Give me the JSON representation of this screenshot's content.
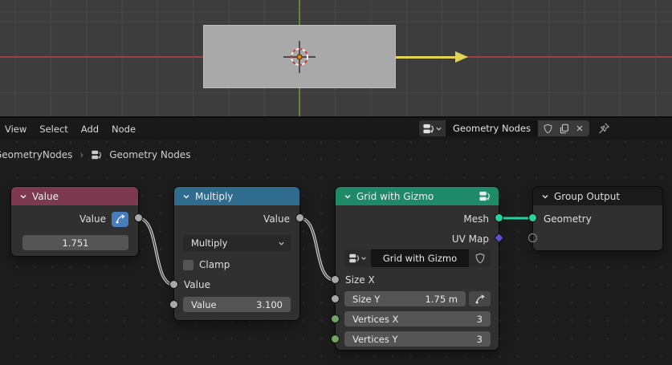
{
  "editor_header": {
    "menus": [
      {
        "label": "View"
      },
      {
        "label": "Select"
      },
      {
        "label": "Add"
      },
      {
        "label": "Node"
      }
    ],
    "tree_selector": {
      "name": "Geometry Nodes"
    }
  },
  "breadcrumb": {
    "modifier": "GeometryNodes",
    "separator": "›",
    "tree_name": "Geometry Nodes"
  },
  "nodes": {
    "value": {
      "title": "Value",
      "output_label": "Value",
      "value_display": "1.751"
    },
    "multiply": {
      "title": "Multiply",
      "output_label": "Value",
      "operation": "Multiply",
      "clamp_label": "Clamp",
      "input_value_label": "Value",
      "field_label": "Value",
      "field_value": "3.100"
    },
    "grid_with_gizmo": {
      "title": "Grid with Gizmo",
      "output_mesh": "Mesh",
      "output_uv_map": "UV Map",
      "name_field": "Grid with Gizmo",
      "input_size_x": "Size X",
      "size_y_label": "Size Y",
      "size_y_value": "1.75 m",
      "vertices_x_label": "Vertices X",
      "vertices_x_value": "3",
      "vertices_y_label": "Vertices Y",
      "vertices_y_value": "3"
    },
    "group_output": {
      "title": "Group Output",
      "input_geometry": "Geometry"
    }
  },
  "colors": {
    "value_header": "#7c3950",
    "multiply_header": "#2f6c8e",
    "grid_header": "#1e8a68",
    "group_output_header": "#1a1a1a",
    "socket_gray": "#a8a8a8",
    "socket_green": "#72a463",
    "socket_teal": "#22d5a2",
    "socket_purple": "#5a52d6",
    "driver_blue": "#477cbd",
    "axis_red": "#9e4043",
    "axis_green": "#65853b",
    "gizmo_yellow": "#e2d44e"
  }
}
